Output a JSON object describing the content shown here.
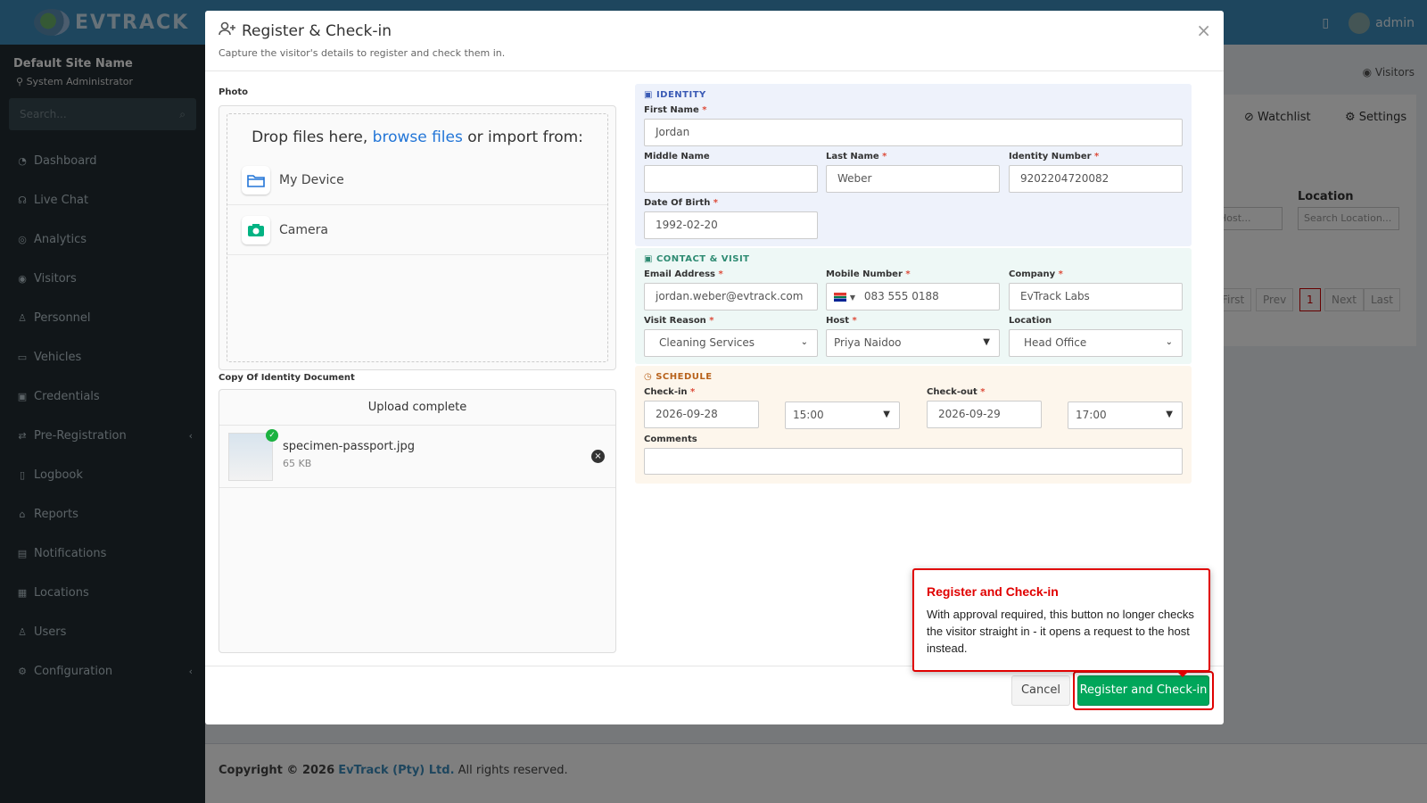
{
  "topbar": {
    "brand": "EVTRACK",
    "user": "admin"
  },
  "sidebar": {
    "site_name": "Default Site Name",
    "role": "System Administrator",
    "search_placeholder": "Search...",
    "items": [
      {
        "label": "Dashboard",
        "icon": "dashboard-icon"
      },
      {
        "label": "Live Chat",
        "icon": "headset-icon"
      },
      {
        "label": "Analytics",
        "icon": "target-icon"
      },
      {
        "label": "Visitors",
        "icon": "eye-icon"
      },
      {
        "label": "Personnel",
        "icon": "users-icon"
      },
      {
        "label": "Vehicles",
        "icon": "car-icon"
      },
      {
        "label": "Credentials",
        "icon": "id-card-icon"
      },
      {
        "label": "Pre-Registration",
        "icon": "exchange-icon"
      },
      {
        "label": "Logbook",
        "icon": "book-icon"
      },
      {
        "label": "Reports",
        "icon": "chart-icon"
      },
      {
        "label": "Notifications",
        "icon": "bell-icon"
      },
      {
        "label": "Locations",
        "icon": "building-icon"
      },
      {
        "label": "Users",
        "icon": "user-icon"
      },
      {
        "label": "Configuration",
        "icon": "gear-icon"
      }
    ]
  },
  "background": {
    "breadcrumb": "Visitors",
    "tab_watchlist": "Watchlist",
    "tab_settings": "Settings",
    "location_label": "Location",
    "host_placeholder": "Host...",
    "location_placeholder": "Search Location...",
    "pagination": [
      "First",
      "Prev",
      "1",
      "Next",
      "Last"
    ]
  },
  "footer": {
    "copyright": "Copyright © 2026",
    "company": "EvTrack (Pty) Ltd.",
    "rights": "All rights reserved."
  },
  "modal": {
    "title": "Register & Check-in",
    "subtitle": "Capture the visitor's details to register and check them in.",
    "photo_label": "Photo",
    "dropzone": {
      "prefix": "Drop files here,",
      "link": "browse files",
      "suffix": "or import from:",
      "sources": [
        "My Device",
        "Camera"
      ]
    },
    "copy_label": "Copy Of Identity Document",
    "upload": {
      "status": "Upload complete",
      "file_name": "specimen-passport.jpg",
      "file_size": "65 KB"
    },
    "identity": {
      "title": "IDENTITY",
      "first_name_label": "First Name",
      "first_name": "Jordan",
      "middle_name_label": "Middle Name",
      "middle_name": "",
      "last_name_label": "Last Name",
      "last_name": "Weber",
      "id_number_label": "Identity Number",
      "id_number": "9202204720082",
      "dob_label": "Date Of Birth",
      "dob": "1992-02-20"
    },
    "contact": {
      "title": "CONTACT & VISIT",
      "email_label": "Email Address",
      "email": "jordan.weber@evtrack.com",
      "mobile_label": "Mobile Number",
      "mobile": "083 555 0188",
      "company_label": "Company",
      "company": "EvTrack Labs",
      "reason_label": "Visit Reason",
      "reason": "Cleaning Services",
      "host_label": "Host",
      "host": "Priya Naidoo",
      "location_label": "Location",
      "location": "Head Office"
    },
    "schedule": {
      "title": "SCHEDULE",
      "checkin_label": "Check-in",
      "checkin_date": "2026-09-28",
      "checkin_time": "15:00",
      "checkout_label": "Check-out",
      "checkout_date": "2026-09-29",
      "checkout_time": "17:00",
      "comments_label": "Comments",
      "comments": ""
    },
    "cancel_label": "Cancel",
    "submit_label": "Register and Check-in"
  },
  "tooltip": {
    "title": "Register and Check-in",
    "body": "With approval required, this button no longer checks the visitor straight in - it opens a request to the host instead."
  },
  "colors": {
    "topbar": "#3c8dbc",
    "sidebar": "#222d32",
    "primary": "#00a65a",
    "highlight": "#e00000",
    "link": "#2275d7"
  }
}
